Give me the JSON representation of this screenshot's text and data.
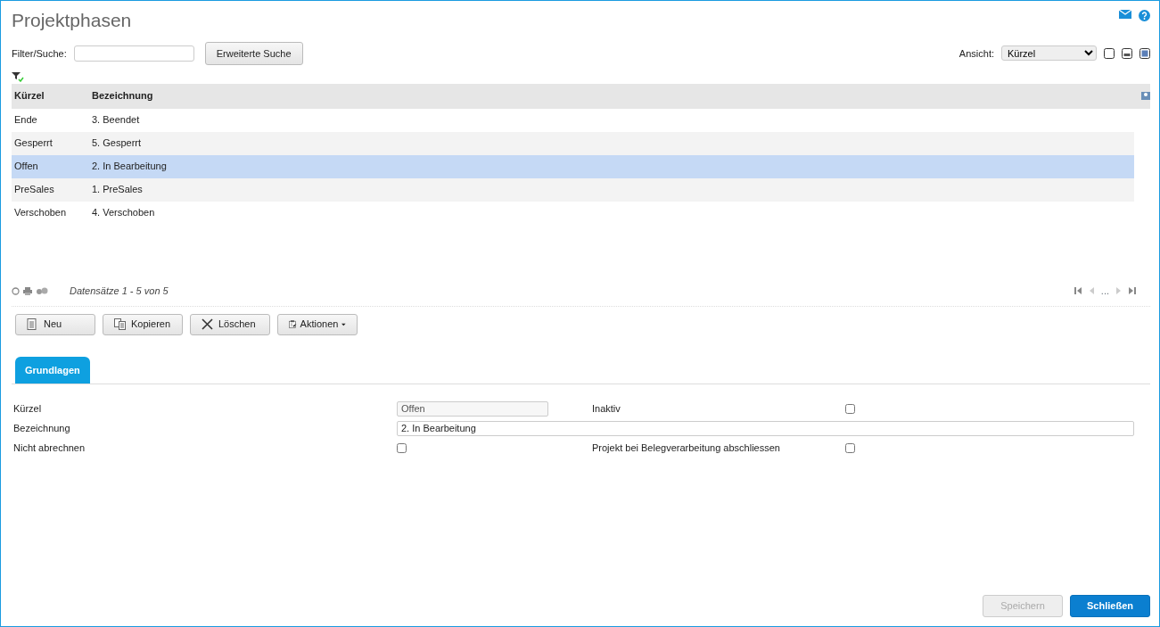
{
  "title": "Projektphasen",
  "filter": {
    "label": "Filter/Suche:",
    "button": "Erweiterte Suche"
  },
  "view": {
    "label": "Ansicht:",
    "value": "Kürzel"
  },
  "table": {
    "columns": [
      "Kürzel",
      "Bezeichnung"
    ],
    "rows": [
      {
        "cells": [
          "Ende",
          "3. Beendet"
        ],
        "selected": false
      },
      {
        "cells": [
          "Gesperrt",
          "5. Gesperrt"
        ],
        "selected": false
      },
      {
        "cells": [
          "Offen",
          "2. In Bearbeitung"
        ],
        "selected": true
      },
      {
        "cells": [
          "PreSales",
          "1. PreSales"
        ],
        "selected": false
      },
      {
        "cells": [
          "Verschoben",
          "4. Verschoben"
        ],
        "selected": false
      }
    ]
  },
  "records": "Datensätze 1 - 5 von 5",
  "pager": {
    "ellipsis": "..."
  },
  "actions": [
    {
      "label": "Neu",
      "kind": "new"
    },
    {
      "label": "Kopieren",
      "kind": "copy"
    },
    {
      "label": "Löschen",
      "kind": "delete"
    },
    {
      "label": "Aktionen",
      "kind": "menu"
    }
  ],
  "tabs": [
    {
      "label": "Grundlagen",
      "selected": true
    }
  ],
  "form": {
    "kuerzel": {
      "label": "Kürzel",
      "value": "Offen",
      "disabled": true
    },
    "inaktiv": {
      "label": "Inaktiv",
      "checked": false
    },
    "bezeichnung": {
      "label": "Bezeichnung",
      "value": "2. In Bearbeitung"
    },
    "nicht_abrechnen": {
      "label": "Nicht abrechnen",
      "checked": false
    },
    "abschliessen": {
      "label": "Projekt bei Belegverarbeitung abschliessen",
      "checked": false
    }
  },
  "footer": [
    {
      "label": "Speichern",
      "disabled": true,
      "primary": false
    },
    {
      "label": "Schließen",
      "disabled": false,
      "primary": true
    }
  ]
}
